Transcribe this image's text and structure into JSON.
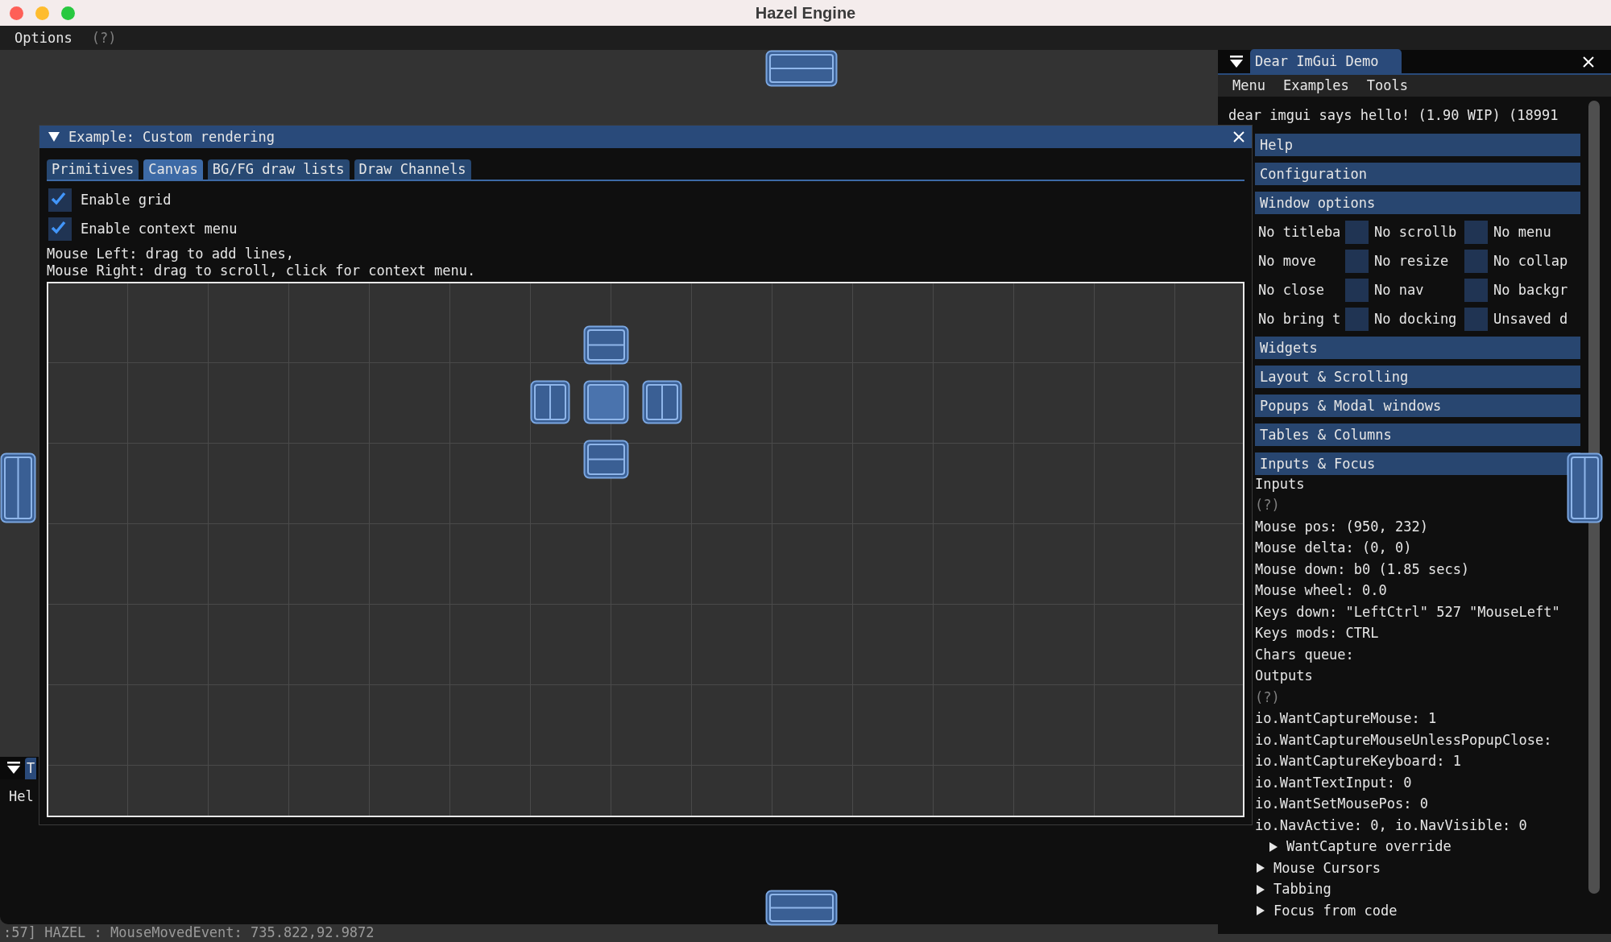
{
  "window": {
    "title": "Hazel Engine"
  },
  "menu_bar": {
    "items": [
      "Options"
    ],
    "help": "(?)"
  },
  "custom_rendering": {
    "title": "Example: Custom rendering",
    "tabs": [
      {
        "label": "Primitives",
        "selected": false
      },
      {
        "label": "Canvas",
        "selected": true
      },
      {
        "label": "BG/FG draw lists",
        "selected": false
      },
      {
        "label": "Draw Channels",
        "selected": false
      }
    ],
    "checkboxes": [
      {
        "label": "Enable grid",
        "checked": true
      },
      {
        "label": "Enable context menu",
        "checked": true
      }
    ],
    "instructions": [
      "Mouse Left: drag to add lines,",
      "Mouse Right: drag to scroll, click for context menu."
    ]
  },
  "bottom_window": {
    "tab": "T",
    "text": "Hel"
  },
  "console": {
    "line": ":57] HAZEL : MouseMovedEvent: 735.822,92.9872"
  },
  "demo_window": {
    "tab": "Dear ImGui Demo",
    "menus": [
      "Menu",
      "Examples",
      "Tools"
    ],
    "hello": "dear imgui says hello! (1.90 WIP) (18991",
    "headers_top": [
      "Help",
      "Configuration",
      "Window options"
    ],
    "window_options": [
      [
        {
          "label": "No titleba",
          "checked": false
        },
        {
          "label": "No scrollb",
          "checked": false
        },
        {
          "label": "No menu"
        }
      ],
      [
        {
          "label": "No move",
          "checked": false
        },
        {
          "label": "No resize",
          "checked": false
        },
        {
          "label": "No collap"
        }
      ],
      [
        {
          "label": "No close",
          "checked": false
        },
        {
          "label": "No nav",
          "checked": false
        },
        {
          "label": "No backgr"
        }
      ],
      [
        {
          "label": "No bring t",
          "checked": false
        },
        {
          "label": "No docking",
          "checked": false
        },
        {
          "label": "Unsaved d"
        }
      ]
    ],
    "headers": [
      "Widgets",
      "Layout & Scrolling",
      "Popups & Modal windows",
      "Tables & Columns",
      "Inputs & Focus"
    ],
    "inputs_lines": [
      {
        "kind": "text",
        "text": "Inputs"
      },
      {
        "kind": "help",
        "text": "(?)"
      },
      {
        "kind": "text",
        "text": "Mouse pos: (950, 232)"
      },
      {
        "kind": "text",
        "text": "Mouse delta: (0, 0)"
      },
      {
        "kind": "text",
        "text": "Mouse down: b0 (1.85 secs)"
      },
      {
        "kind": "text",
        "text": "Mouse wheel: 0.0"
      },
      {
        "kind": "text",
        "text": "Keys down: \"LeftCtrl\" 527 \"MouseLeft\""
      },
      {
        "kind": "text",
        "text": "Keys mods: CTRL"
      },
      {
        "kind": "text",
        "text": "Chars queue:"
      },
      {
        "kind": "text",
        "text": "Outputs"
      },
      {
        "kind": "help",
        "text": "(?)"
      },
      {
        "kind": "text",
        "text": "io.WantCaptureMouse: 1"
      },
      {
        "kind": "text",
        "text": "io.WantCaptureMouseUnlessPopupClose:"
      },
      {
        "kind": "text",
        "text": "io.WantCaptureKeyboard: 1"
      },
      {
        "kind": "text",
        "text": "io.WantTextInput: 0"
      },
      {
        "kind": "text",
        "text": "io.WantSetMousePos: 0"
      },
      {
        "kind": "text",
        "text": "io.NavActive: 0, io.NavVisible: 0"
      },
      {
        "kind": "tree_node",
        "text": "WantCapture override",
        "expanded": false
      }
    ],
    "tree_nodes": [
      {
        "label": "Mouse Cursors",
        "expanded": false
      },
      {
        "label": "Tabbing",
        "expanded": false
      },
      {
        "label": "Focus from code",
        "expanded": false
      }
    ]
  }
}
